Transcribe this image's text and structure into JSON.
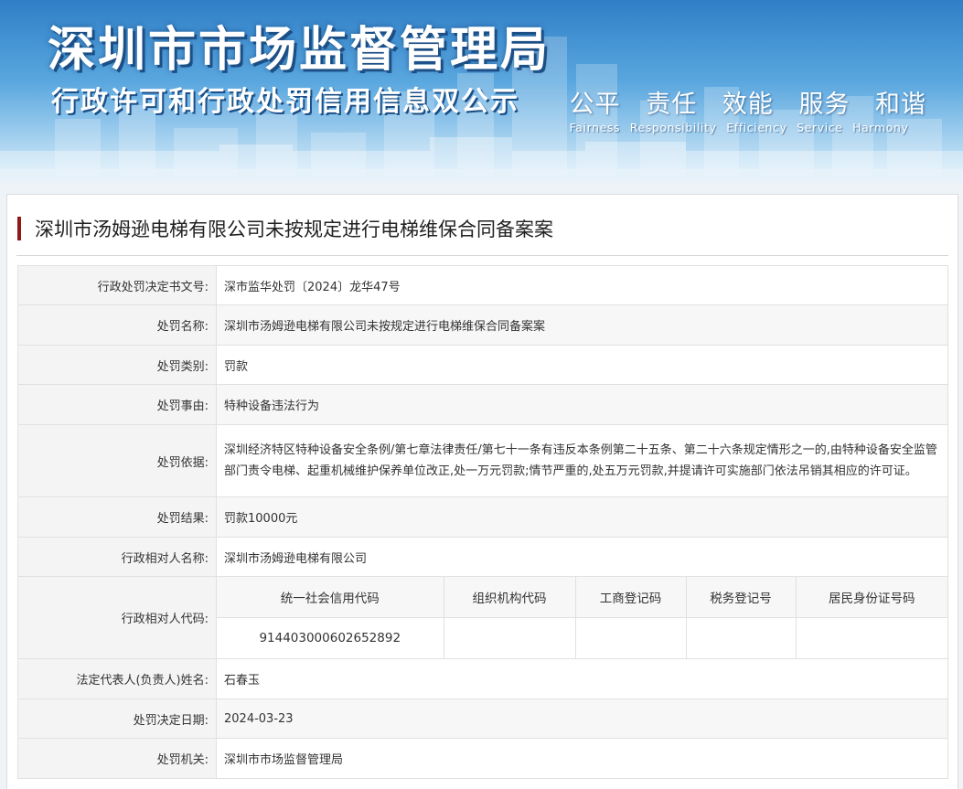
{
  "banner": {
    "title": "深圳市市场监督管理局",
    "subtitle": "行政许可和行政处罚信用信息双公示",
    "slogan_cn": [
      "公平",
      "责任",
      "效能",
      "服务",
      "和谐"
    ],
    "slogan_en": [
      "Fairness",
      "Responsibility",
      "Efficiency",
      "Service",
      "Harmony"
    ]
  },
  "case": {
    "title": "深圳市汤姆逊电梯有限公司未按规定进行电梯维保合同备案案",
    "accent_color": "#8f1a1a"
  },
  "rows": [
    {
      "label": "行政处罚决定书文号:",
      "value": "深市监华处罚〔2024〕龙华47号"
    },
    {
      "label": "处罚名称:",
      "value": "深圳市汤姆逊电梯有限公司未按规定进行电梯维保合同备案案"
    },
    {
      "label": "处罚类别:",
      "value": "罚款"
    },
    {
      "label": "处罚事由:",
      "value": "特种设备违法行为"
    },
    {
      "label": "处罚依据:",
      "value": "深圳经济特区特种设备安全条例/第七章法律责任/第七十一条有违反本条例第二十五条、第二十六条规定情形之一的,由特种设备安全监管部门责令电梯、起重机械维护保养单位改正,处一万元罚款;情节严重的,处五万元罚款,并提请许可实施部门依法吊销其相应的许可证。"
    },
    {
      "label": "处罚结果:",
      "value": "罚款10000元"
    },
    {
      "label": "行政相对人名称:",
      "value": "深圳市汤姆逊电梯有限公司"
    }
  ],
  "codes": {
    "label": "行政相对人代码:",
    "headers": [
      "统一社会信用代码",
      "组织机构代码",
      "工商登记码",
      "税务登记号",
      "居民身份证号码"
    ],
    "values": [
      "914403000602652892",
      "",
      "",
      "",
      ""
    ]
  },
  "rows_after": [
    {
      "label": "法定代表人(负责人)姓名:",
      "value": "石春玉"
    },
    {
      "label": "处罚决定日期:",
      "value": "2024-03-23"
    },
    {
      "label": "处罚机关:",
      "value": "深圳市市场监督管理局"
    }
  ]
}
